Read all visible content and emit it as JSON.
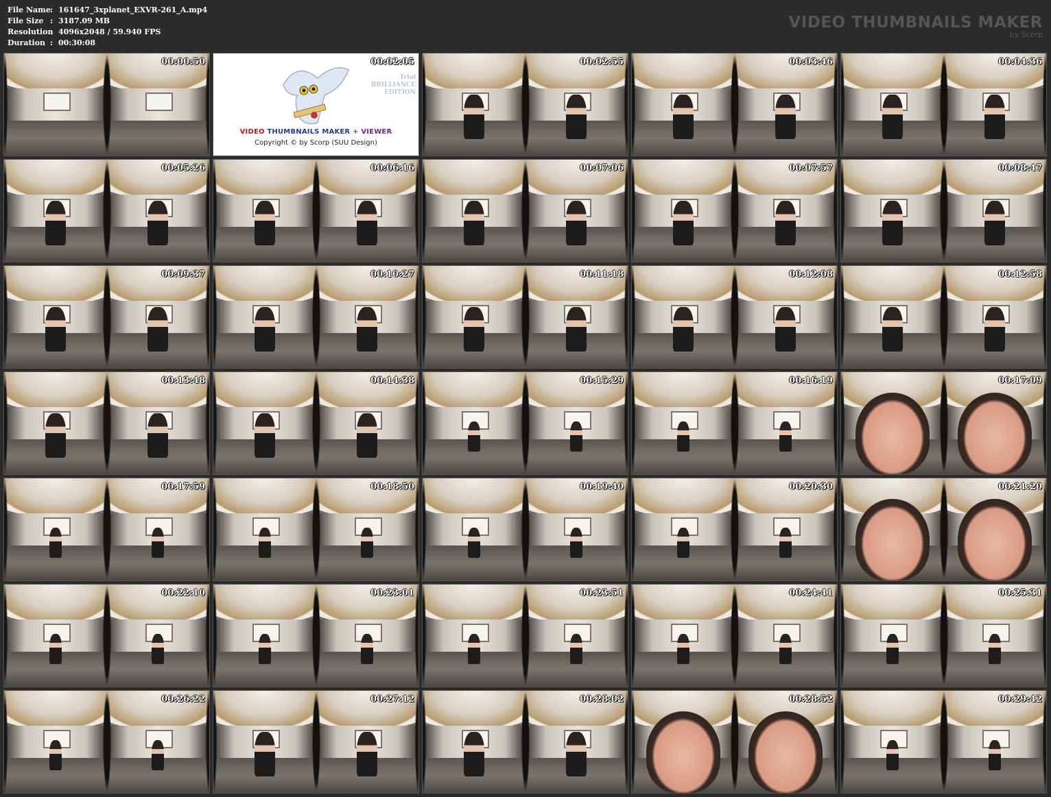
{
  "info": {
    "rows": [
      {
        "label": "File Name",
        "sep": ":",
        "value": "161647_3xplanet_EXVR-261_A.mp4"
      },
      {
        "label": "File Size",
        "sep": ":",
        "value": "3187.09 MB"
      },
      {
        "label": "Resolution",
        "sep": ":",
        "value": "4096x2048 / 59.940 FPS"
      },
      {
        "label": "Duration",
        "sep": ":",
        "value": "00:30:08"
      }
    ]
  },
  "brand": {
    "title": "VIDEO THUMBNAILS MAKER",
    "subtitle": "by Scorp"
  },
  "logo_tile": {
    "timestamp": "00:02:05",
    "edition_line1": "Trial",
    "edition_line2": "BRILLIANCE",
    "edition_line3": "EDITION",
    "title_part1": "VIDEO",
    "title_part2": "THUMBNAILS MAKER",
    "title_part3": "+",
    "title_part4": "VIEWER",
    "copyright": "Copyright © by Scorp (SUU Design)"
  },
  "thumbnails": [
    {
      "timestamp": "00:00:50",
      "scene": "empty"
    },
    {
      "timestamp": "LOGO",
      "scene": "logo"
    },
    {
      "timestamp": "00:02:55",
      "scene": "figure"
    },
    {
      "timestamp": "00:03:46",
      "scene": "figure"
    },
    {
      "timestamp": "00:04:36",
      "scene": "figure"
    },
    {
      "timestamp": "00:05:26",
      "scene": "figure"
    },
    {
      "timestamp": "00:06:16",
      "scene": "figure"
    },
    {
      "timestamp": "00:07:06",
      "scene": "figure"
    },
    {
      "timestamp": "00:07:57",
      "scene": "figure"
    },
    {
      "timestamp": "00:08:47",
      "scene": "figure"
    },
    {
      "timestamp": "00:09:37",
      "scene": "figure"
    },
    {
      "timestamp": "00:10:27",
      "scene": "figure"
    },
    {
      "timestamp": "00:11:18",
      "scene": "figure"
    },
    {
      "timestamp": "00:12:08",
      "scene": "figure"
    },
    {
      "timestamp": "00:12:58",
      "scene": "figure"
    },
    {
      "timestamp": "00:13:48",
      "scene": "figure"
    },
    {
      "timestamp": "00:14:38",
      "scene": "figure"
    },
    {
      "timestamp": "00:15:29",
      "scene": "small"
    },
    {
      "timestamp": "00:16:19",
      "scene": "small"
    },
    {
      "timestamp": "00:17:09",
      "scene": "closeup"
    },
    {
      "timestamp": "00:17:59",
      "scene": "small"
    },
    {
      "timestamp": "00:18:50",
      "scene": "small"
    },
    {
      "timestamp": "00:19:40",
      "scene": "small"
    },
    {
      "timestamp": "00:20:30",
      "scene": "small"
    },
    {
      "timestamp": "00:21:20",
      "scene": "closeup"
    },
    {
      "timestamp": "00:22:10",
      "scene": "small"
    },
    {
      "timestamp": "00:23:01",
      "scene": "small"
    },
    {
      "timestamp": "00:23:51",
      "scene": "small"
    },
    {
      "timestamp": "00:24:41",
      "scene": "small"
    },
    {
      "timestamp": "00:25:31",
      "scene": "small"
    },
    {
      "timestamp": "00:26:22",
      "scene": "small"
    },
    {
      "timestamp": "00:27:12",
      "scene": "figure"
    },
    {
      "timestamp": "00:28:02",
      "scene": "figure"
    },
    {
      "timestamp": "00:28:52",
      "scene": "closeup"
    },
    {
      "timestamp": "00:29:42",
      "scene": "small"
    }
  ]
}
